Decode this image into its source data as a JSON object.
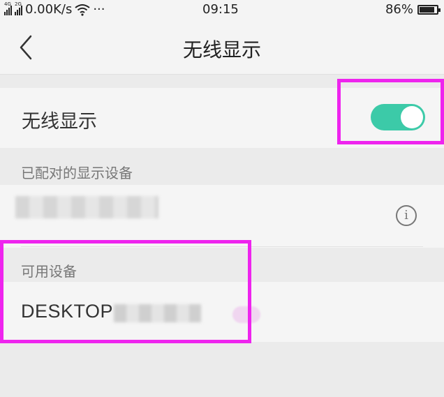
{
  "status_bar": {
    "network1": "4G",
    "network2": "2G",
    "speed": "0.00K/s",
    "more": "···",
    "time": "09:15",
    "battery": "86%",
    "battery_level": 0.86
  },
  "header": {
    "title": "无线显示"
  },
  "wireless_display": {
    "label": "无线显示",
    "enabled": true,
    "toggle_color": "#3ccaa8"
  },
  "paired_section": {
    "heading": "已配对的显示设备"
  },
  "available_section": {
    "heading": "可用设备",
    "device_name": "DESKTOP"
  },
  "highlight_color": "#ee24ee",
  "icons": {
    "back": "chevron-left-icon",
    "info": "info-icon",
    "wifi": "wifi-icon",
    "battery": "battery-icon"
  }
}
